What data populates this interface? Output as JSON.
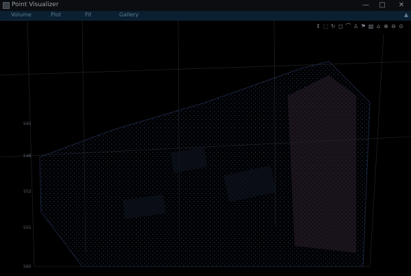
{
  "window": {
    "title": "Point Visualizer",
    "min_glyph": "—",
    "max_glyph": "□",
    "close_glyph": "✕"
  },
  "menu": {
    "items": [
      "Volume",
      "Plot",
      "Fit",
      "Gallery"
    ],
    "right_glyph": "▲"
  },
  "toolbar": {
    "tools": [
      {
        "name": "pan-icon",
        "glyph": "↕"
      },
      {
        "name": "select-icon",
        "glyph": "⬚"
      },
      {
        "name": "rotate-icon",
        "glyph": "↻"
      },
      {
        "name": "box-icon",
        "glyph": "◻"
      },
      {
        "name": "lasso-icon",
        "glyph": "⌒"
      },
      {
        "name": "person-icon",
        "glyph": "♙"
      },
      {
        "name": "flag-icon",
        "glyph": "⚑"
      },
      {
        "name": "image-icon",
        "glyph": "▧"
      },
      {
        "name": "home-icon",
        "glyph": "⌂"
      },
      {
        "name": "zoom-in-icon",
        "glyph": "⊕"
      },
      {
        "name": "zoom-out-icon",
        "glyph": "⊖"
      },
      {
        "name": "fit-icon",
        "glyph": "⊙"
      }
    ]
  },
  "axis": {
    "ticks": [
      "545",
      "548",
      "552",
      "555",
      "560"
    ]
  },
  "colors": {
    "point_primary": "#1f2f52",
    "point_accent": "#2b4860",
    "building": "#3a2a36"
  }
}
